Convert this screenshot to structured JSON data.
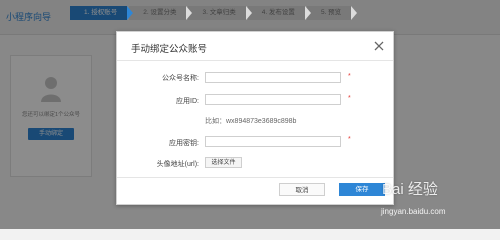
{
  "app": {
    "title": "小程序向导"
  },
  "steps": [
    {
      "label": "1. 授权账号",
      "active": true
    },
    {
      "label": "2. 设置分类",
      "active": false
    },
    {
      "label": "3. 文章归类",
      "active": false
    },
    {
      "label": "4. 发布设置",
      "active": false
    },
    {
      "label": "5. 预览",
      "active": false
    }
  ],
  "account_card": {
    "text": "您还可以绑定1个公众号",
    "button_label": "手动绑定",
    "avatar_icon": "user-silhouette-icon"
  },
  "dialog": {
    "title": "手动绑定公众账号",
    "close_icon": "close-icon",
    "fields": [
      {
        "label": "公众号名称:",
        "value": "",
        "required": true
      },
      {
        "label": "应用ID:",
        "value": "",
        "required": true
      },
      {
        "label": "应用密钥:",
        "value": "",
        "required": true
      }
    ],
    "required_mark": "*",
    "appid_hint": "比如：wx894873e3689c898b",
    "avatar": {
      "label": "头像地址(url):",
      "button_label": "选择文件"
    },
    "cancel_label": "取消",
    "save_label": "保存"
  },
  "colors": {
    "primary": "#2e86d6",
    "required": "#e53935",
    "overlay": "rgba(0,0,0,0.45)"
  },
  "watermark": {
    "logo_text": "Bai  经验",
    "url": "jingyan.baidu.com"
  }
}
